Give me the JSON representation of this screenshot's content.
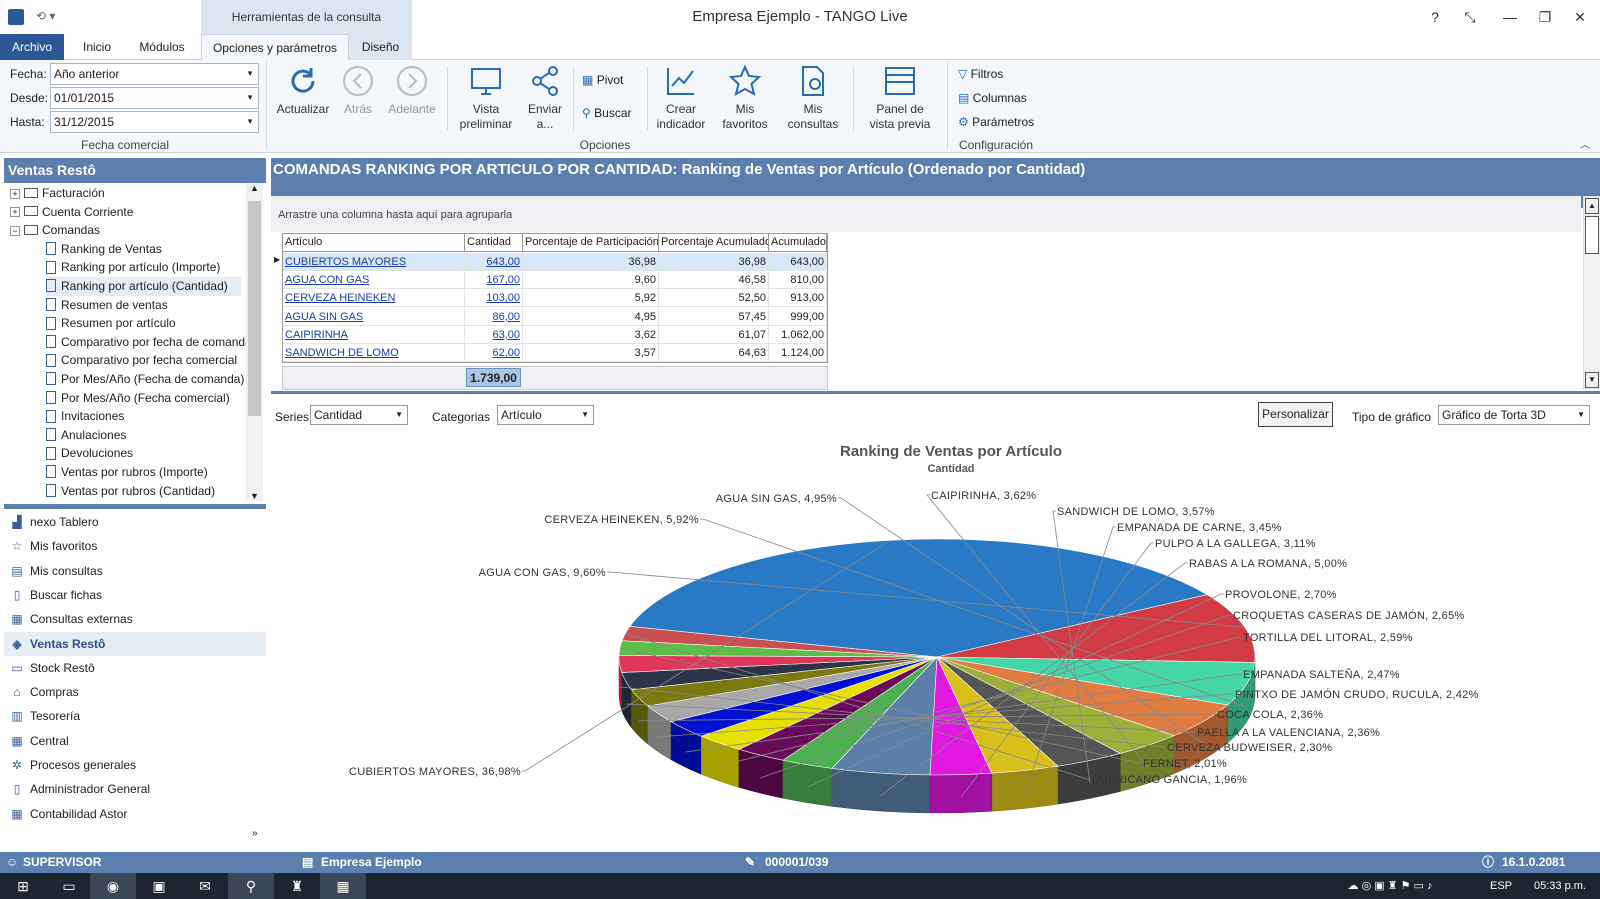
{
  "window": {
    "title": "Empresa Ejemplo - TANGO  Live",
    "context_tab": "Herramientas de la consulta",
    "help_label": "?",
    "restore_label": "❐",
    "close_label": "✕"
  },
  "tabs": [
    "Archivo",
    "Inicio",
    "Módulos",
    "Opciones y parámetros",
    "Diseño"
  ],
  "ribbon": {
    "fecha_label": "Fecha:",
    "fecha_value": "Año anterior",
    "desde_label": "Desde:",
    "desde_value": "01/01/2015",
    "hasta_label": "Hasta:",
    "hasta_value": "31/12/2015",
    "group_fecha": "Fecha comercial",
    "actualizar": "Actualizar",
    "atras": "Atrás",
    "adelante": "Adelante",
    "vista_1": "Vista",
    "vista_2": "preliminar",
    "enviar_1": "Enviar",
    "enviar_2": "a...",
    "pivot": "Pivot",
    "buscar": "Buscar",
    "crear_1": "Crear",
    "crear_2": "indicador",
    "favoritos_1": "Mis",
    "favoritos_2": "favoritos",
    "consultas_1": "Mis",
    "consultas_2": "consultas",
    "group_opciones": "Opciones",
    "panel_1": "Panel de",
    "panel_2": "vista previa",
    "filtros": "Filtros",
    "columnas": "Columnas",
    "parametros": "Parámetros",
    "group_config": "Configuración"
  },
  "left_panel": {
    "title": "Ventas Restô",
    "tree": [
      {
        "label": "Facturación",
        "kind": "folder",
        "state": "+"
      },
      {
        "label": "Cuenta Corriente",
        "kind": "folder",
        "state": "+"
      },
      {
        "label": "Comandas",
        "kind": "folder",
        "state": "−"
      },
      {
        "label": "Ranking de Ventas",
        "kind": "doc"
      },
      {
        "label": "Ranking por artículo (Importe)",
        "kind": "doc"
      },
      {
        "label": "Ranking por artículo (Cantidad)",
        "kind": "doc",
        "selected": true
      },
      {
        "label": "Resumen de ventas",
        "kind": "doc"
      },
      {
        "label": "Resumen por artículo",
        "kind": "doc"
      },
      {
        "label": "Comparativo por fecha de comanda",
        "kind": "doc"
      },
      {
        "label": "Comparativo por fecha comercial",
        "kind": "doc"
      },
      {
        "label": "Por Mes/Año (Fecha de comanda)",
        "kind": "doc"
      },
      {
        "label": "Por Mes/Año (Fecha comercial)",
        "kind": "doc"
      },
      {
        "label": "Invitaciones",
        "kind": "doc"
      },
      {
        "label": "Anulaciones",
        "kind": "doc"
      },
      {
        "label": "Devoluciones",
        "kind": "doc"
      },
      {
        "label": "Ventas por rubros (Importe)",
        "kind": "doc"
      },
      {
        "label": "Ventas por rubros (Cantidad)",
        "kind": "doc"
      }
    ],
    "nav": [
      {
        "label": "nexo Tablero",
        "icon": "chart-icon"
      },
      {
        "label": "Mis favoritos",
        "icon": "star-icon"
      },
      {
        "label": "Mis consultas",
        "icon": "query-icon"
      },
      {
        "label": "Buscar fichas",
        "icon": "search-doc-icon"
      },
      {
        "label": "Consultas externas",
        "icon": "external-icon"
      },
      {
        "label": "Ventas Restô",
        "icon": "tag-icon",
        "active": true
      },
      {
        "label": "Stock Restô",
        "icon": "stock-icon"
      },
      {
        "label": "Compras",
        "icon": "cart-icon"
      },
      {
        "label": "Tesorería",
        "icon": "treasury-icon"
      },
      {
        "label": "Central",
        "icon": "central-icon"
      },
      {
        "label": "Procesos generales",
        "icon": "process-icon"
      },
      {
        "label": "Administrador General",
        "icon": "admin-icon"
      },
      {
        "label": "Contabilidad Astor",
        "icon": "accounting-icon"
      }
    ]
  },
  "content": {
    "title": "COMANDAS RANKING POR ARTICULO POR CANTIDAD: Ranking de Ventas por Artículo (Ordenado por Cantidad)",
    "group_hint": "Arrastre una columna hasta aquí para agruparla",
    "columns": [
      "Artículo",
      "Cantidad",
      "Porcentaje de Participación",
      "Porcentaje Acumulado",
      "Acumulado"
    ],
    "rows": [
      [
        "CUBIERTOS MAYORES",
        "643,00",
        "36,98",
        "36,98",
        "643,00"
      ],
      [
        "AGUA CON GAS",
        "167,00",
        "9,60",
        "46,58",
        "810,00"
      ],
      [
        "CERVEZA HEINEKEN",
        "103,00",
        "5,92",
        "52,50",
        "913,00"
      ],
      [
        "AGUA SIN GAS",
        "86,00",
        "4,95",
        "57,45",
        "999,00"
      ],
      [
        "CAIPIRINHA",
        "63,00",
        "3,62",
        "61,07",
        "1.062,00"
      ],
      [
        "SANDWICH DE LOMO",
        "62,00",
        "3,57",
        "64,63",
        "1.124,00"
      ]
    ],
    "total": "1.739,00"
  },
  "chart_controls": {
    "series_label": "Series",
    "series_value": "Cantidad",
    "categorias_label": "Categorias",
    "categorias_value": "Artículo",
    "personalizar": "Personalizar",
    "tipo_label": "Tipo de gráfico",
    "tipo_value": "Gráfico de Torta 3D"
  },
  "chart_data": {
    "type": "pie",
    "title": "Ranking de Ventas por Artículo",
    "subtitle": "Cantidad",
    "slices": [
      {
        "label": "CUBIERTOS MAYORES, 36,98%",
        "value": 36.98,
        "color": "#2a79c4"
      },
      {
        "label": "AGUA CON GAS, 9,60%",
        "value": 9.6,
        "color": "#d23a44"
      },
      {
        "label": "CERVEZA HEINEKEN, 5,92%",
        "value": 5.92,
        "color": "#45d6a8"
      },
      {
        "label": "AGUA SIN GAS, 4,95%",
        "value": 4.95,
        "color": "#e07d43"
      },
      {
        "label": "CAIPIRINHA, 3,62%",
        "value": 3.62,
        "color": "#9cb03a"
      },
      {
        "label": "SANDWICH DE LOMO, 3,57%",
        "value": 3.57,
        "color": "#555555"
      },
      {
        "label": "EMPANADA DE CARNE, 3,45%",
        "value": 3.45,
        "color": "#d9bf1c"
      },
      {
        "label": "PULPO A LA GALLEGA, 3,11%",
        "value": 3.11,
        "color": "#e018e0"
      },
      {
        "label": "RABAS A LA ROMANA, 5,00%",
        "value": 5.0,
        "color": "#5b7fa8"
      },
      {
        "label": "PROVOLONE, 2,70%",
        "value": 2.7,
        "color": "#4caf50"
      },
      {
        "label": "CROQUETAS CASERAS DE JAMÓN, 2,65%",
        "value": 2.65,
        "color": "#6a0a5a"
      },
      {
        "label": "TORTILLA DEL LITORAL, 2,59%",
        "value": 2.59,
        "color": "#e8e000"
      },
      {
        "label": "EMPANADA SALTEÑA, 2,47%",
        "value": 2.47,
        "color": "#0010d0"
      },
      {
        "label": "PINTXO DE JAMÓN CRUDO, RUCULA, 2,42%",
        "value": 2.42,
        "color": "#a8a8a8"
      },
      {
        "label": "COCA COLA, 2,36%",
        "value": 2.36,
        "color": "#7a7a10"
      },
      {
        "label": "PAELLA A LA VALENCIANA, 2,36%",
        "value": 2.36,
        "color": "#2c3548"
      },
      {
        "label": "CERVEZA BUDWEISER, 2,30%",
        "value": 2.3,
        "color": "#e0365c"
      },
      {
        "label": "FERNET, 2,01%",
        "value": 2.01,
        "color": "#5cbf4a"
      },
      {
        "label": "AMERICANO GANCIA, 1,96%",
        "value": 1.96,
        "color": "#c85050"
      }
    ]
  },
  "status": {
    "user": "SUPERVISOR",
    "company": "Empresa Ejemplo",
    "code": "000001/039",
    "version": "16.1.0.2081"
  },
  "taskbar": {
    "lang": "ESP",
    "time": "05:33 p.m."
  }
}
